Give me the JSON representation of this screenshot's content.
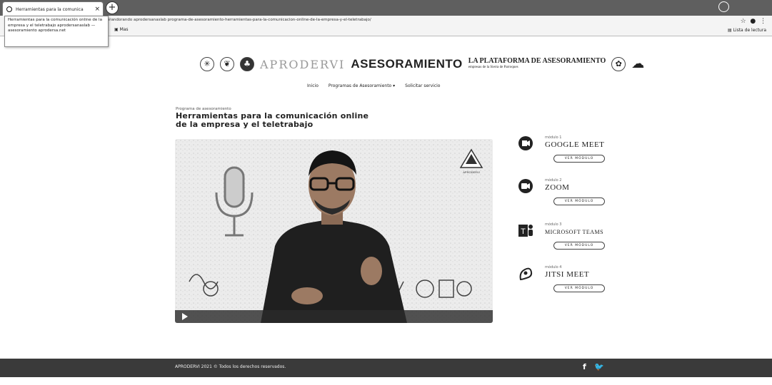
{
  "browser": {
    "tab_title": "Herramientas para la comunica",
    "tab_close": "×",
    "new_tab": "+",
    "url": "forandorando aprodersanaslab programa-de-asesoramiento-herramientas-para-la-comunicacion-online-de-la-empresa-y-el-teletrabajo/",
    "bookmark_label": "Mas",
    "bookmarks_right": "Lista de lectura",
    "tooltip_text": "Herramientas para la comunicación online de la empresa y el teletrabajo aprodersanaslab — asesoramiento aprodersa.net"
  },
  "header": {
    "brand_a": "APRODERVI",
    "brand_b": "ASESORAMIENTO",
    "brand_c": "LA PLATAFORMA DE ASESORAMIENTO",
    "brand_c_sub": "empresas de la Sierra de Parroques"
  },
  "nav": {
    "items": [
      "Inicio",
      "Programas de Asesoramiento ▾",
      "Solicitar servicio"
    ]
  },
  "content": {
    "breadcrumb": "Programa de asesoramiento",
    "title_line1": "Herramientas para la comunicación online",
    "title_line2": "de la empresa y el teletrabajo",
    "video_logo": "APRODERVI"
  },
  "modules": [
    {
      "label": "módulo 1",
      "name": "GOOGLE MEET",
      "button": "VER MÓDULO"
    },
    {
      "label": "módulo 2",
      "name": "ZOOM",
      "button": "VER MÓDULO"
    },
    {
      "label": "módulo 3",
      "name": "MICROSOFT TEAMS",
      "button": "VER MÓDULO"
    },
    {
      "label": "módulo 4",
      "name": "JITSI MEET",
      "button": "VER MÓDULO"
    }
  ],
  "footer": {
    "copyright": "APRODERVI 2021 © Todos los derechos reservados.",
    "facebook": "f",
    "twitter": "🐦"
  },
  "colors": {
    "footer_bg": "#3a3a3a",
    "chrome_bg": "#5f5f5f"
  }
}
